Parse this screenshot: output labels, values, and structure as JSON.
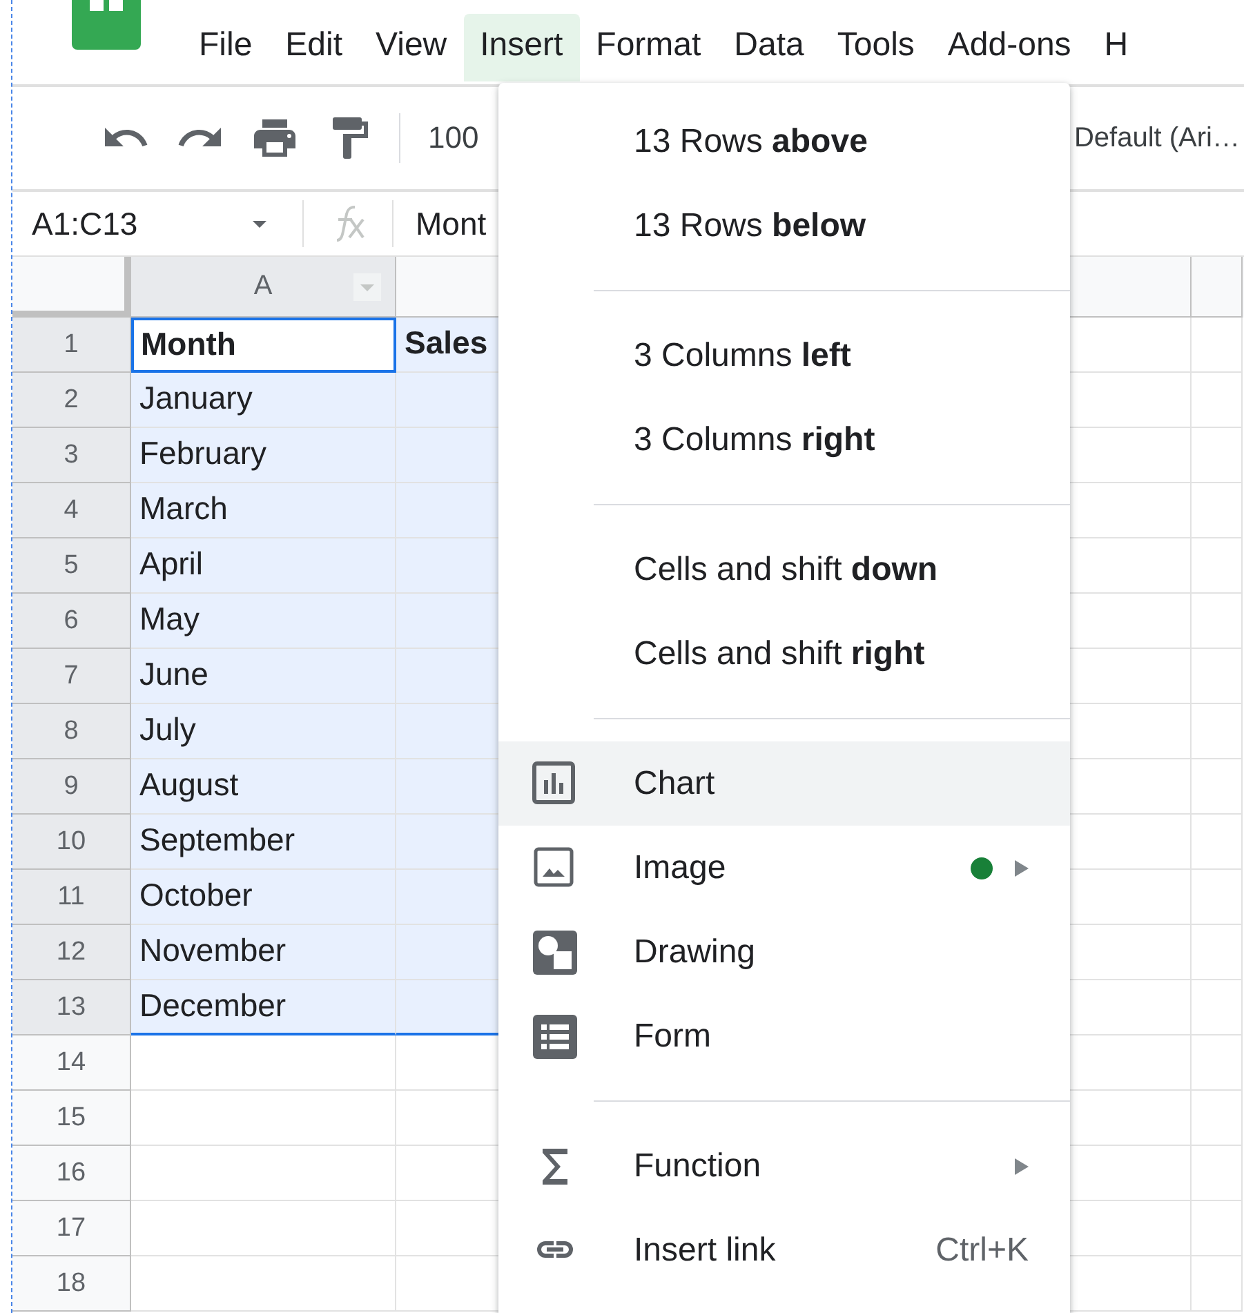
{
  "menu_bar": [
    {
      "label": "File",
      "selected": false
    },
    {
      "label": "Edit",
      "selected": false
    },
    {
      "label": "View",
      "selected": false
    },
    {
      "label": "Insert",
      "selected": true
    },
    {
      "label": "Format",
      "selected": false
    },
    {
      "label": "Data",
      "selected": false
    },
    {
      "label": "Tools",
      "selected": false
    },
    {
      "label": "Add-ons",
      "selected": false
    },
    {
      "label": "H",
      "selected": false
    }
  ],
  "toolbar": {
    "zoom": "100",
    "font": "Default (Ari…"
  },
  "formula_bar": {
    "name_box": "A1:C13",
    "formula": "Mont"
  },
  "columns": [
    {
      "label": "A",
      "selected": true
    }
  ],
  "rows": [
    {
      "number": "1",
      "selected": true,
      "cells": [
        "Month",
        "Sales"
      ]
    },
    {
      "number": "2",
      "selected": true,
      "cells": [
        "January"
      ]
    },
    {
      "number": "3",
      "selected": true,
      "cells": [
        "February"
      ]
    },
    {
      "number": "4",
      "selected": true,
      "cells": [
        "March"
      ]
    },
    {
      "number": "5",
      "selected": true,
      "cells": [
        "April"
      ]
    },
    {
      "number": "6",
      "selected": true,
      "cells": [
        "May"
      ]
    },
    {
      "number": "7",
      "selected": true,
      "cells": [
        "June"
      ]
    },
    {
      "number": "8",
      "selected": true,
      "cells": [
        "July"
      ]
    },
    {
      "number": "9",
      "selected": true,
      "cells": [
        "August"
      ]
    },
    {
      "number": "10",
      "selected": true,
      "cells": [
        "September"
      ]
    },
    {
      "number": "11",
      "selected": true,
      "cells": [
        "October"
      ]
    },
    {
      "number": "12",
      "selected": true,
      "cells": [
        "November"
      ]
    },
    {
      "number": "13",
      "selected": true,
      "cells": [
        "December"
      ]
    },
    {
      "number": "14",
      "selected": false,
      "cells": []
    },
    {
      "number": "15",
      "selected": false,
      "cells": []
    },
    {
      "number": "16",
      "selected": false,
      "cells": []
    },
    {
      "number": "17",
      "selected": false,
      "cells": []
    },
    {
      "number": "18",
      "selected": false,
      "cells": []
    }
  ],
  "insert_menu": [
    {
      "kind": "text",
      "label": "13 Rows **above**",
      "selected": false
    },
    {
      "kind": "text",
      "label": "13 Rows **below**",
      "selected": false
    },
    {
      "kind": "separator"
    },
    {
      "kind": "text",
      "label": "3 Columns **left**",
      "selected": false
    },
    {
      "kind": "text",
      "label": "3 Columns **right**",
      "selected": false
    },
    {
      "kind": "separator"
    },
    {
      "kind": "text",
      "label": "Cells and shift **down**",
      "selected": false
    },
    {
      "kind": "text",
      "label": "Cells and shift **right**",
      "selected": false
    },
    {
      "kind": "separator"
    },
    {
      "kind": "chart",
      "label": "Chart",
      "selected": true
    },
    {
      "kind": "image",
      "label": "Image",
      "selected": false,
      "color": "#188038",
      "submenu": true
    },
    {
      "kind": "drawing",
      "label": "Drawing",
      "selected": false
    },
    {
      "kind": "form",
      "label": "Form",
      "selected": false
    },
    {
      "kind": "separator"
    },
    {
      "kind": "function",
      "label": "Function",
      "selected": false,
      "submenu": true
    },
    {
      "kind": "link",
      "label": "Insert link",
      "selected": false,
      "shortcut": "Ctrl+K"
    }
  ]
}
